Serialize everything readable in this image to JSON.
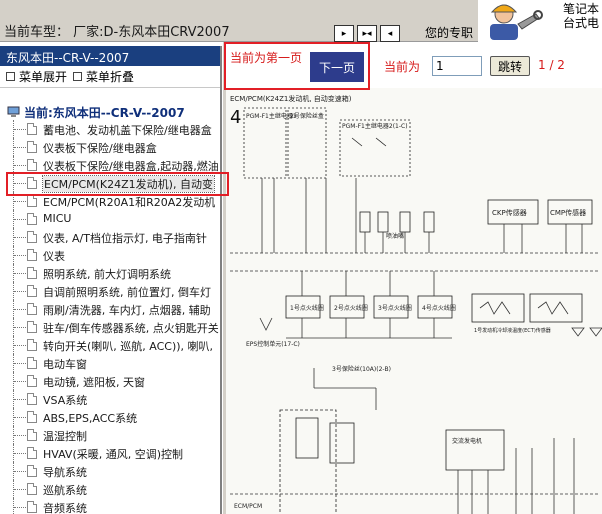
{
  "header": {
    "car_type": "当前车型：  厂家:D-东风本田CRV2007",
    "nav_buttons": [
      {
        "icon": "page-right-icon",
        "glyph": "▸"
      },
      {
        "icon": "split-icon",
        "glyph": "▸◂"
      },
      {
        "icon": "page-left-icon",
        "glyph": "◂"
      }
    ],
    "pro_text": "您的专职",
    "logo_text": [
      "笔记本",
      "台式电"
    ]
  },
  "sidebar": {
    "title": "东风本田--CR-V--2007",
    "expand_label": "菜单展开",
    "collapse_label": "菜单折叠",
    "root_label": "当前:东风本田--CR-V--2007",
    "selected_index": 3,
    "items": [
      {
        "label": "蓄电池、发动机盖下保险/继电器盒"
      },
      {
        "label": "仪表板下保险/继电器盒"
      },
      {
        "label": "仪表板下保险/继电器盒,起动器,燃油"
      },
      {
        "label": "ECM/PCM(K24Z1发动机), 自动变"
      },
      {
        "label": "ECM/PCM(R20A1和R20A2发动机"
      },
      {
        "label": "MICU"
      },
      {
        "label": "仪表, A/T档位指示灯, 电子指南针"
      },
      {
        "label": "仪表"
      },
      {
        "label": "照明系统, 前大灯调明系统"
      },
      {
        "label": "自调前照明系统, 前位置灯, 倒车灯"
      },
      {
        "label": "雨刷/清洗器, 车内灯, 点烟器, 辅助"
      },
      {
        "label": "驻车/倒车传感器系统, 点火钥匙开关"
      },
      {
        "label": "转向开关(喇叭, 巡航, ACC)), 喇叭,"
      },
      {
        "label": "电动车窗"
      },
      {
        "label": "电动镜, 遮阳板, 天窗"
      },
      {
        "label": "VSA系统"
      },
      {
        "label": "ABS,EPS,ACC系统"
      },
      {
        "label": "温湿控制"
      },
      {
        "label": "HVAV(采暖, 通风, 空调)控制"
      },
      {
        "label": "导航系统"
      },
      {
        "label": "巡航系统"
      },
      {
        "label": "音频系统"
      }
    ]
  },
  "pager": {
    "now_text": "当前为第一页",
    "next_label": "下一页",
    "current_label": "当前为",
    "page_value": "1",
    "go_label": "跳转",
    "count_text": "1 / 2"
  },
  "schematic": {
    "title": "ECM/PCM(K24Z1发动机, 自动变速箱)",
    "page_no": "4",
    "fuse_left": "PGM-F1主继电器1\n(2-B)",
    "fuse_mid": "2号保险\n丝盒(燃油\n泵)(15A)\n(2-B)",
    "relay2": "PGM-F1主继电器2(1-C)",
    "injector": "喷油嘴",
    "inj_nos": [
      "No1",
      "No2",
      "No3",
      "No4"
    ],
    "wire_colors": [
      "黄/黑",
      "黑/白",
      "黄",
      "黄/黑",
      "黄/黑",
      "蓝"
    ],
    "ckp": "CKP传感器",
    "cmp": "CMP传感器",
    "pins_top": [
      "IG1",
      "MRLY",
      "IGP",
      "INJ1",
      "INJ2",
      "INJ3",
      "INJ4",
      "CKP",
      "CMPB"
    ],
    "pins_row2": [
      "IMOFPR",
      "IGPLS1",
      "IGPLS2",
      "IGPLS3",
      "IGPLS4",
      "ECT1",
      "SG2",
      "ECT2",
      "CMP"
    ],
    "coils": [
      "1号点火线圈",
      "2号点火线圈",
      "3号点火线圈",
      "4号点火线圈"
    ],
    "ect1": "1号发动机冷却液温度(ECT)传感器",
    "ect2": "2号发动机冷却液温度(ECT)传感器",
    "eps": "EPS控制单元(17-C)",
    "fuse_bottom": "3号保险丝(10A)(2-B)",
    "alt": "交流发电机",
    "pins_bottom": [
      "CMPA",
      "K5",
      "SHOD5",
      "SO2STRTC",
      "ALTF",
      "ALTC",
      "BKSW",
      "BKSWNC",
      "FAM"
    ],
    "ecm": "ECM/PCM"
  },
  "highlights": [
    {
      "target": "pager-now"
    },
    {
      "target": "selected-item"
    }
  ]
}
